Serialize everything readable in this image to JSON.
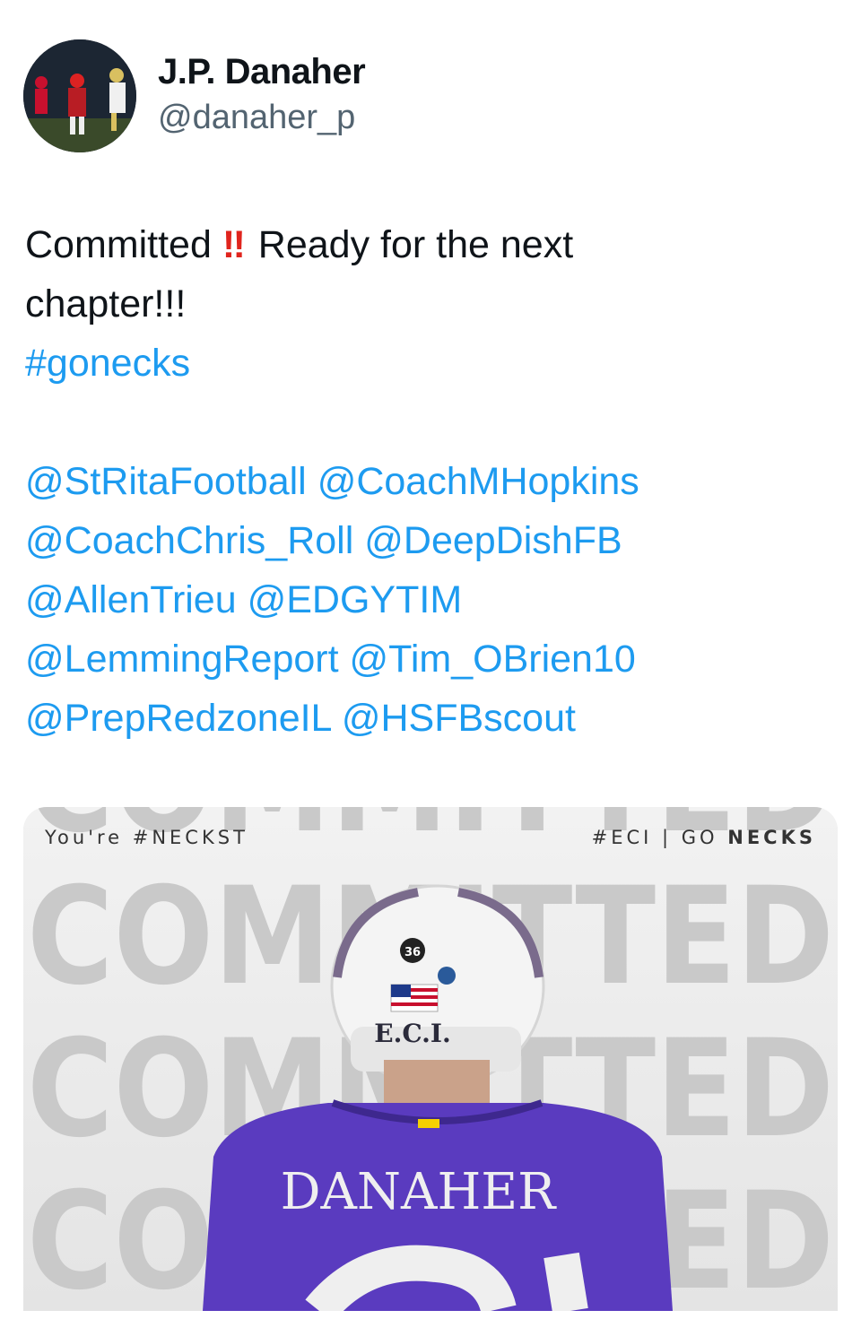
{
  "author": {
    "name": "J.P. Danaher",
    "handle": "@danaher_p"
  },
  "tweet": {
    "text_part1": "Committed",
    "emoji": "‼",
    "text_part2": " Ready for the next",
    "text_line2": "chapter!!!",
    "hashtag": "#gonecks",
    "mentions": [
      [
        "@StRitaFootball",
        "@CoachMHopkins"
      ],
      [
        "@CoachChris_Roll",
        "@DeepDishFB"
      ],
      [
        "@AllenTrieu",
        "@EDGYTIM"
      ],
      [
        "@LemmingReport",
        "@Tim_OBrien10"
      ],
      [
        "@PrepRedzoneIL",
        "@HSFBscout"
      ]
    ]
  },
  "media": {
    "top_left": "You're #NECKST",
    "top_right_prefix": "#ECI | GO ",
    "top_right_bold": "NECKS",
    "background_word": "COMMITTED",
    "jersey_name": "DANAHER",
    "helmet_text": "E.C.I.",
    "helmet_sticker": "36",
    "jersey_color": "#5a3bbf",
    "link_color": "#1d9bf0"
  }
}
